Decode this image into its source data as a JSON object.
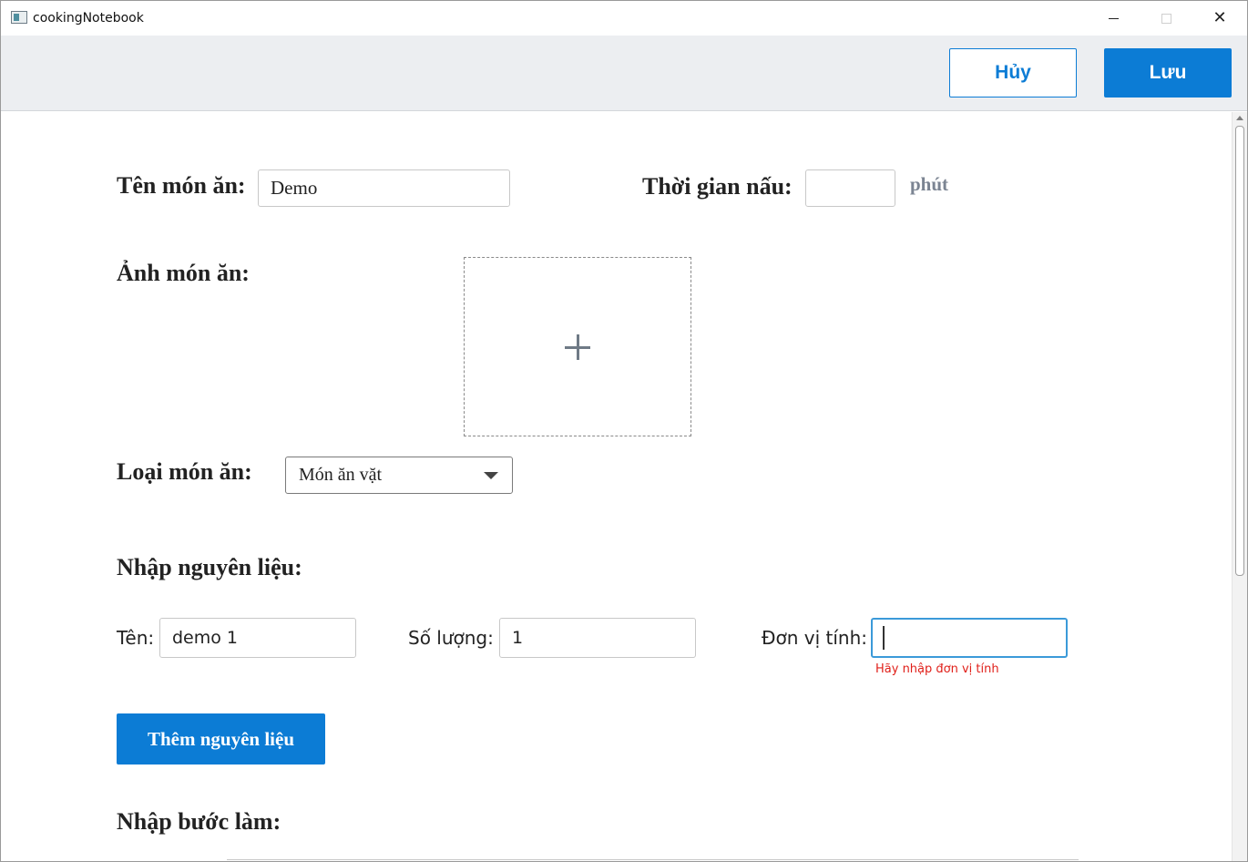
{
  "window": {
    "title": "cookingNotebook",
    "minimize_icon": "minimize-icon",
    "maximize_icon": "maximize-icon",
    "close_icon": "close-icon",
    "close_glyph": "✕"
  },
  "toolbar": {
    "cancel_label": "Hủy",
    "save_label": "Lưu",
    "accent_color": "#0c7cd5"
  },
  "form": {
    "dish_name_label": "Tên món ăn:",
    "dish_name_value": "Demo",
    "cook_time_label": "Thời gian nấu:",
    "cook_time_value": "",
    "cook_time_unit": "phút",
    "image_label": "Ảnh món ăn:",
    "image_placeholder_icon": "plus-icon",
    "category_label": "Loại món ăn:",
    "category_selected": "Món ăn vặt",
    "ingredients_heading": "Nhập nguyên liệu:",
    "ingredient": {
      "name_label": "Tên:",
      "name_value": "demo 1",
      "quantity_label": "Số lượng:",
      "quantity_value": "1",
      "unit_label": "Đơn vị tính:",
      "unit_value": "",
      "unit_error": "Hãy nhập đơn vị tính",
      "error_color": "#e0201a"
    },
    "add_ingredient_label": "Thêm nguyên liệu",
    "steps_heading": "Nhập bước làm:"
  }
}
